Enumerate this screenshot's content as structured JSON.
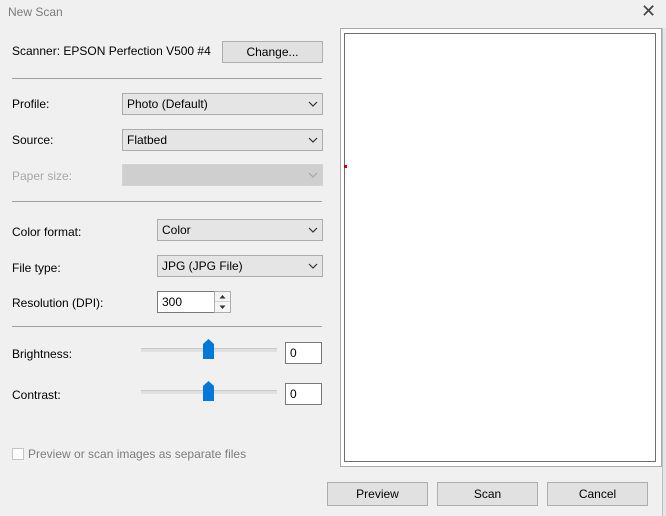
{
  "window": {
    "title": "New Scan",
    "close_icon": "close-icon"
  },
  "scanner": {
    "label": "Scanner: EPSON Perfection V500 #4",
    "change_button": "Change..."
  },
  "profile": {
    "label": "Profile:",
    "value": "Photo (Default)"
  },
  "source": {
    "label": "Source:",
    "value": "Flatbed"
  },
  "paper_size": {
    "label": "Paper size:",
    "value": ""
  },
  "color_format": {
    "label": "Color format:",
    "value": "Color"
  },
  "file_type": {
    "label": "File type:",
    "value": "JPG (JPG File)"
  },
  "resolution": {
    "label": "Resolution (DPI):",
    "value": "300"
  },
  "brightness": {
    "label": "Brightness:",
    "value": "0",
    "level": 0.5
  },
  "contrast": {
    "label": "Contrast:",
    "value": "0",
    "level": 0.5
  },
  "separate_files": {
    "label": "Preview or scan images as separate files",
    "checked": false
  },
  "buttons": {
    "preview": "Preview",
    "scan": "Scan",
    "cancel": "Cancel"
  },
  "colors": {
    "slider_thumb": "#0078d7",
    "preview_marker": "#cc0000"
  }
}
